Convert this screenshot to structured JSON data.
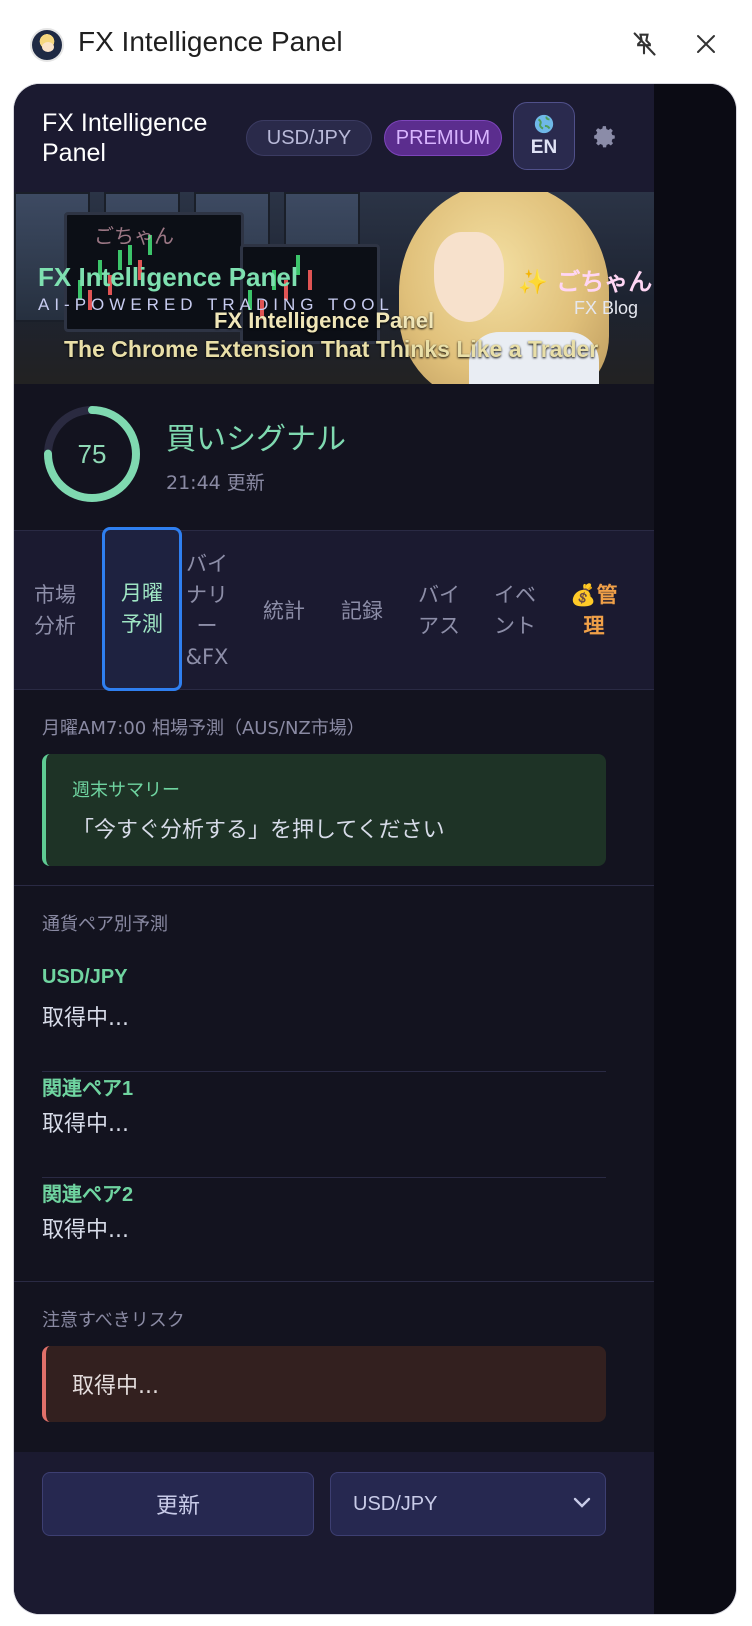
{
  "chrome": {
    "title": "FX Intelligence Panel"
  },
  "header": {
    "title": "FX Intelligence Panel",
    "pair_badge": "USD/JPY",
    "plan_badge": "PREMIUM",
    "lang_label": "EN",
    "icons": [
      "globe-icon",
      "gear-icon"
    ]
  },
  "banner": {
    "title": "FX Intelligence Panel",
    "subtitle": "AI-POWERED TRADING TOOL",
    "brand": "✨ ごちゃん",
    "blog": "FX Blog",
    "caption_1": "FX Intelligence Panel",
    "caption_2": "The Chrome Extension That Thinks Like a Trader",
    "watermark": "ごちゃん"
  },
  "signal": {
    "score": "75",
    "score_fraction": 0.75,
    "label": "買いシグナル",
    "updated": "21:44 更新",
    "accent": "#7fd9b0"
  },
  "tabs": [
    {
      "label": "市場\n分析"
    },
    {
      "label": "月曜\n予測"
    },
    {
      "label": "バイ\nナリ\nー\n&FX"
    },
    {
      "label": "統計"
    },
    {
      "label": "記録"
    },
    {
      "label": "バイ\nアス"
    },
    {
      "label": "イベ\nント"
    },
    {
      "label": "💰管\n理"
    }
  ],
  "monday": {
    "section_title": "月曜AM7:00 相場予測（AUS/NZ市場）",
    "summary_label": "週末サマリー",
    "summary_text": "「今すぐ分析する」を押してください"
  },
  "pairs": {
    "section_title": "通貨ペア別予測",
    "items": [
      {
        "name": "USD/JPY",
        "value": "取得中..."
      },
      {
        "name": "関連ペア1",
        "value": "取得中..."
      },
      {
        "name": "関連ペア2",
        "value": "取得中..."
      }
    ]
  },
  "risk": {
    "section_title": "注意すべきリスク",
    "text": "取得中..."
  },
  "footer": {
    "refresh_label": "更新",
    "pair_select_value": "USD/JPY"
  }
}
